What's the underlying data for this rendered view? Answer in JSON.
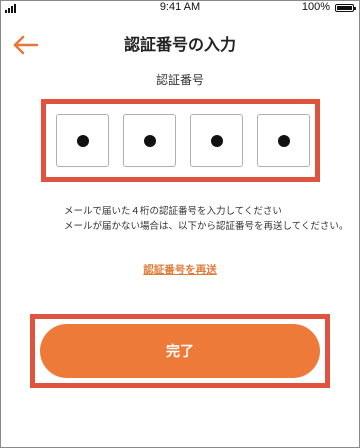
{
  "status_bar": {
    "time": "9:41 AM",
    "battery": "100%",
    "battery_level": 1.0
  },
  "header": {
    "title": "認証番号の入力",
    "back_icon": "arrow-left-icon"
  },
  "code_input": {
    "label": "認証番号",
    "digits": [
      "●",
      "●",
      "●",
      "●"
    ]
  },
  "instructions": {
    "line1": "メールで届いた４桁の認証番号を入力してください",
    "line2": "メールが届かない場合は、以下から認証番号を再送してください。"
  },
  "resend_link": "認証番号を再送",
  "done_button": "完了",
  "colors": {
    "accent": "#ee7a3a",
    "highlight": "#e0533f"
  }
}
